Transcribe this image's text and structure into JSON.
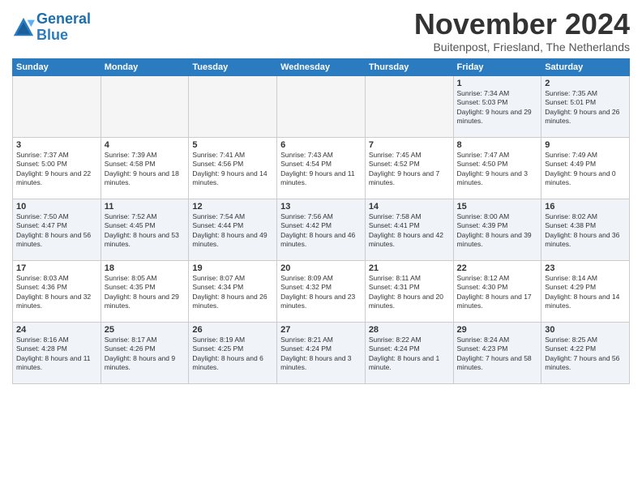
{
  "header": {
    "logo_line1": "General",
    "logo_line2": "Blue",
    "month_title": "November 2024",
    "subtitle": "Buitenpost, Friesland, The Netherlands"
  },
  "days_of_week": [
    "Sunday",
    "Monday",
    "Tuesday",
    "Wednesday",
    "Thursday",
    "Friday",
    "Saturday"
  ],
  "weeks": [
    [
      {
        "day": "",
        "info": ""
      },
      {
        "day": "",
        "info": ""
      },
      {
        "day": "",
        "info": ""
      },
      {
        "day": "",
        "info": ""
      },
      {
        "day": "",
        "info": ""
      },
      {
        "day": "1",
        "info": "Sunrise: 7:34 AM\nSunset: 5:03 PM\nDaylight: 9 hours and 29 minutes."
      },
      {
        "day": "2",
        "info": "Sunrise: 7:35 AM\nSunset: 5:01 PM\nDaylight: 9 hours and 26 minutes."
      }
    ],
    [
      {
        "day": "3",
        "info": "Sunrise: 7:37 AM\nSunset: 5:00 PM\nDaylight: 9 hours and 22 minutes."
      },
      {
        "day": "4",
        "info": "Sunrise: 7:39 AM\nSunset: 4:58 PM\nDaylight: 9 hours and 18 minutes."
      },
      {
        "day": "5",
        "info": "Sunrise: 7:41 AM\nSunset: 4:56 PM\nDaylight: 9 hours and 14 minutes."
      },
      {
        "day": "6",
        "info": "Sunrise: 7:43 AM\nSunset: 4:54 PM\nDaylight: 9 hours and 11 minutes."
      },
      {
        "day": "7",
        "info": "Sunrise: 7:45 AM\nSunset: 4:52 PM\nDaylight: 9 hours and 7 minutes."
      },
      {
        "day": "8",
        "info": "Sunrise: 7:47 AM\nSunset: 4:50 PM\nDaylight: 9 hours and 3 minutes."
      },
      {
        "day": "9",
        "info": "Sunrise: 7:49 AM\nSunset: 4:49 PM\nDaylight: 9 hours and 0 minutes."
      }
    ],
    [
      {
        "day": "10",
        "info": "Sunrise: 7:50 AM\nSunset: 4:47 PM\nDaylight: 8 hours and 56 minutes."
      },
      {
        "day": "11",
        "info": "Sunrise: 7:52 AM\nSunset: 4:45 PM\nDaylight: 8 hours and 53 minutes."
      },
      {
        "day": "12",
        "info": "Sunrise: 7:54 AM\nSunset: 4:44 PM\nDaylight: 8 hours and 49 minutes."
      },
      {
        "day": "13",
        "info": "Sunrise: 7:56 AM\nSunset: 4:42 PM\nDaylight: 8 hours and 46 minutes."
      },
      {
        "day": "14",
        "info": "Sunrise: 7:58 AM\nSunset: 4:41 PM\nDaylight: 8 hours and 42 minutes."
      },
      {
        "day": "15",
        "info": "Sunrise: 8:00 AM\nSunset: 4:39 PM\nDaylight: 8 hours and 39 minutes."
      },
      {
        "day": "16",
        "info": "Sunrise: 8:02 AM\nSunset: 4:38 PM\nDaylight: 8 hours and 36 minutes."
      }
    ],
    [
      {
        "day": "17",
        "info": "Sunrise: 8:03 AM\nSunset: 4:36 PM\nDaylight: 8 hours and 32 minutes."
      },
      {
        "day": "18",
        "info": "Sunrise: 8:05 AM\nSunset: 4:35 PM\nDaylight: 8 hours and 29 minutes."
      },
      {
        "day": "19",
        "info": "Sunrise: 8:07 AM\nSunset: 4:34 PM\nDaylight: 8 hours and 26 minutes."
      },
      {
        "day": "20",
        "info": "Sunrise: 8:09 AM\nSunset: 4:32 PM\nDaylight: 8 hours and 23 minutes."
      },
      {
        "day": "21",
        "info": "Sunrise: 8:11 AM\nSunset: 4:31 PM\nDaylight: 8 hours and 20 minutes."
      },
      {
        "day": "22",
        "info": "Sunrise: 8:12 AM\nSunset: 4:30 PM\nDaylight: 8 hours and 17 minutes."
      },
      {
        "day": "23",
        "info": "Sunrise: 8:14 AM\nSunset: 4:29 PM\nDaylight: 8 hours and 14 minutes."
      }
    ],
    [
      {
        "day": "24",
        "info": "Sunrise: 8:16 AM\nSunset: 4:28 PM\nDaylight: 8 hours and 11 minutes."
      },
      {
        "day": "25",
        "info": "Sunrise: 8:17 AM\nSunset: 4:26 PM\nDaylight: 8 hours and 9 minutes."
      },
      {
        "day": "26",
        "info": "Sunrise: 8:19 AM\nSunset: 4:25 PM\nDaylight: 8 hours and 6 minutes."
      },
      {
        "day": "27",
        "info": "Sunrise: 8:21 AM\nSunset: 4:24 PM\nDaylight: 8 hours and 3 minutes."
      },
      {
        "day": "28",
        "info": "Sunrise: 8:22 AM\nSunset: 4:24 PM\nDaylight: 8 hours and 1 minute."
      },
      {
        "day": "29",
        "info": "Sunrise: 8:24 AM\nSunset: 4:23 PM\nDaylight: 7 hours and 58 minutes."
      },
      {
        "day": "30",
        "info": "Sunrise: 8:25 AM\nSunset: 4:22 PM\nDaylight: 7 hours and 56 minutes."
      }
    ]
  ]
}
